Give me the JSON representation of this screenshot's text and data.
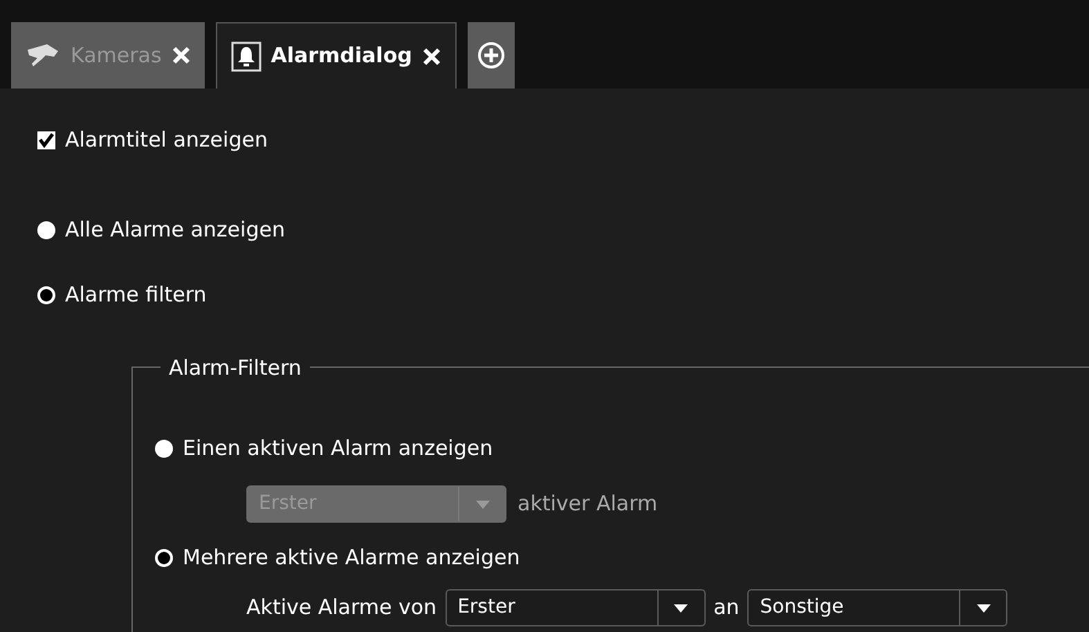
{
  "tabs": [
    {
      "label": "Kameras",
      "selected": false
    },
    {
      "label": "Alarmdialog",
      "selected": true
    }
  ],
  "show_alarm_title": {
    "label": "Alarmtitel anzeigen",
    "checked": true
  },
  "mode_options": [
    {
      "label": "Alle Alarme anzeigen",
      "selected": false
    },
    {
      "label": "Alarme filtern",
      "selected": true
    }
  ],
  "alarm_filter": {
    "legend": "Alarm-Filtern",
    "single": {
      "label": "Einen aktiven Alarm anzeigen",
      "selected": false,
      "dropdown": {
        "value": "Erster",
        "disabled": true
      },
      "suffix": "aktiver Alarm"
    },
    "multiple": {
      "label": "Mehrere aktive Alarme anzeigen",
      "selected": true,
      "prefix": "Aktive Alarme von",
      "from": {
        "value": "Erster",
        "disabled": false
      },
      "between": "an",
      "to": {
        "value": "Sonstige",
        "disabled": false
      }
    }
  }
}
